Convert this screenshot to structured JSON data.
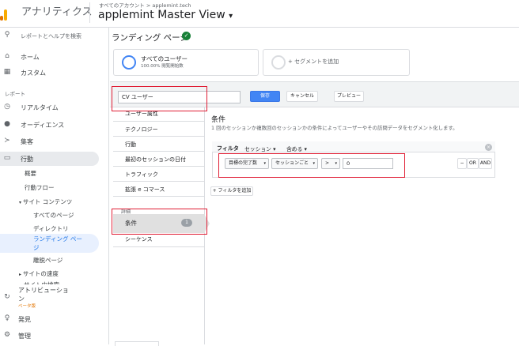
{
  "header": {
    "app_name": "アナリティクス",
    "account_path": "すべてのアカウント > applemint.tech",
    "view_name": "applemint Master View",
    "view_chevron": "▾"
  },
  "sidebar": {
    "search": "レポートとヘルプを検索",
    "home": "ホーム",
    "custom": "カスタム",
    "section_reports": "レポート",
    "realtime": "リアルタイム",
    "audience": "オーディエンス",
    "acquisition": "集客",
    "behavior": "行動",
    "overview": "概要",
    "behavior_flow": "行動フロー",
    "site_content": "サイト コンテンツ",
    "all_pages": "すべてのページ",
    "directory": "ディレクトリ",
    "landing_page_line1": "ランディング ペー",
    "landing_page_line2": "ジ",
    "exit_pages": "離脱ページ",
    "site_speed": "サイトの速度",
    "site_search": "サイト内検索",
    "attribution_line1": "アトリビューショ",
    "attribution_line2": "ン",
    "beta": "ベータ版",
    "discover": "発見",
    "admin": "管理",
    "icons": [
      "search-icon",
      "home-icon",
      "dashboard-icon",
      "clock-icon",
      "person-icon",
      "acquisition-icon",
      "behavior-icon",
      "attribution-icon",
      "lightbulb-icon",
      "gear-icon"
    ]
  },
  "main": {
    "page_title": "ランディング ページ",
    "segment_all_users": "すべてのユーザー",
    "segment_all_users_sub": "100.00% 閲覧開始数",
    "add_segment": "+ セグメントを追加"
  },
  "segment_editor": {
    "name_value": "CV ユーザー",
    "save": "保存",
    "cancel": "キャンセル",
    "preview": "プレビュー",
    "nav": [
      "ユーザー属性",
      "テクノロジー",
      "行動",
      "最初のセッションの日付",
      "トラフィック",
      "拡張 e コマース"
    ],
    "advanced_label": "詳細",
    "conditions": "条件",
    "conditions_count": "1",
    "sequences": "シーケンス",
    "conditions_title": "条件",
    "conditions_desc": "1 回のセッションか複数回のセッションかの条件によってユーザーやその訪問データをセグメント化します。",
    "filter_label": "フィルタ",
    "filter_scope": "セッション ▾",
    "filter_include": "含める ▾",
    "metric": "目標の完了数",
    "scope": "セッションごと",
    "operator": ">",
    "value": "0",
    "minus": "−",
    "or": "OR",
    "and": "AND",
    "add_filter": "+ フィルタを追加",
    "close_glyph": "×"
  },
  "colors": {
    "accent_blue": "#4285f4",
    "highlight_red": "#e01e35",
    "logo_orange": "#f9ab00",
    "logo_dark": "#e37400",
    "check_green": "#188038"
  }
}
